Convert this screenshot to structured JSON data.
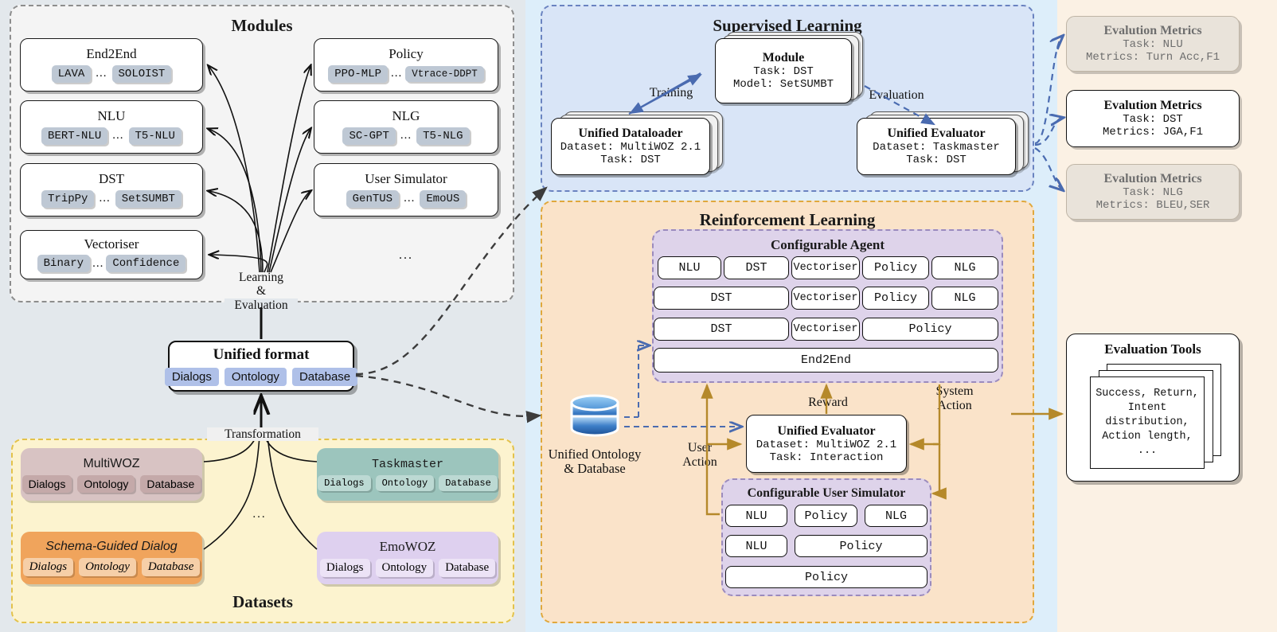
{
  "bands": {
    "left_bg": "#e3e8ec",
    "mid_bg": "#ddeefa",
    "right_bg": "#fbf1e4"
  },
  "modules": {
    "title": "Modules",
    "ellipsis": "...",
    "boxes": [
      {
        "name": "End2End",
        "title": "End2End",
        "left": "LAVA",
        "sep": "...",
        "right": "SOLOIST"
      },
      {
        "name": "NLU",
        "title": "NLU",
        "left": "BERT-NLU",
        "sep": "...",
        "right": "T5-NLU"
      },
      {
        "name": "DST",
        "title": "DST",
        "left": "TripPy",
        "sep": "...",
        "right": "SetSUMBT"
      },
      {
        "name": "Vectoriser",
        "title": "Vectoriser",
        "left": "Binary",
        "sep": "...",
        "right": "Confidence"
      },
      {
        "name": "Policy",
        "title": "Policy",
        "left": "PPO-MLP",
        "sep": "...",
        "right": "Vtrace-DDPT"
      },
      {
        "name": "NLG",
        "title": "NLG",
        "left": "SC-GPT",
        "sep": "...",
        "right": "T5-NLG"
      },
      {
        "name": "User Simulator",
        "title": "User Simulator",
        "left": "GenTUS",
        "sep": "...",
        "right": "EmoUS"
      }
    ]
  },
  "learning_eval_label": "Learning\n&\nEvaluation",
  "learning_eval_lines": [
    "Learning",
    "&",
    "Evaluation"
  ],
  "unified_format": {
    "title": "Unified format",
    "chips": [
      "Dialogs",
      "Ontology",
      "Database"
    ]
  },
  "transformation_label": "Transformation",
  "datasets": {
    "title": "Datasets",
    "ellipsis": "...",
    "items": [
      {
        "name": "MultiWOZ",
        "title": "MultiWOZ",
        "chips": [
          "Dialogs",
          "Ontology",
          "Database"
        ],
        "box_color": "#d8c3c3",
        "chip_color": "#c4a9a9",
        "font": "sans",
        "style": "normal",
        "title_color": "#1a1a1a"
      },
      {
        "name": "Taskmaster",
        "title": "Taskmaster",
        "chips": [
          "Dialogs",
          "Ontology",
          "Database"
        ],
        "box_color": "#9cc5bd",
        "chip_color": "#bcd9d3",
        "font": "mono",
        "style": "normal",
        "title_color": "#1a1a1a"
      },
      {
        "name": "Schema-Guided Dialog",
        "title": "Schema-Guided Dialog",
        "chips": [
          "Dialogs",
          "Ontology",
          "Database"
        ],
        "box_color": "#f0a košice",
        "chip_color": "#f6cfa8",
        "font": "sans",
        "style": "italic",
        "title_color": "#1a1a1a"
      },
      {
        "name": "EmoWOZ",
        "title": "EmoWOZ",
        "chips": [
          "Dialogs",
          "Ontology",
          "Database"
        ],
        "box_color": "#ded0ef",
        "chip_color": "#ece3f6",
        "font": "serif",
        "style": "normal",
        "title_color": "#1a1a1a"
      }
    ]
  },
  "supervised_learning": {
    "title": "Supervised Learning",
    "module_card": {
      "title": "Module",
      "lines": [
        "Task: DST",
        "Model: SetSUMBT"
      ]
    },
    "dataloader_card": {
      "title": "Unified Dataloader",
      "lines": [
        "Dataset: MultiWOZ 2.1",
        "Task: DST"
      ]
    },
    "evaluator_card": {
      "title": "Unified Evaluator",
      "lines": [
        "Dataset: Taskmaster",
        "Task: DST"
      ]
    },
    "training_label": "Training",
    "evaluation_label": "Evaluation"
  },
  "evaluation_metrics": [
    {
      "title": "Evalution Metrics",
      "task": "Task: NLU",
      "metrics": "Metrics: Turn Acc,F1",
      "active": false
    },
    {
      "title": "Evalution Metrics",
      "task": "Task: DST",
      "metrics": "Metrics: JGA,F1",
      "active": true
    },
    {
      "title": "Evalution Metrics",
      "task": "Task: NLG",
      "metrics": "Metrics: BLEU,SER",
      "active": false
    }
  ],
  "reinforcement_learning": {
    "title": "Reinforcement Learning",
    "agent": {
      "title": "Configurable Agent",
      "rows": [
        [
          "NLU",
          "DST",
          "Vectoriser",
          "Policy",
          "NLG"
        ],
        [
          "DST",
          "Vectoriser",
          "Policy",
          "NLG"
        ],
        [
          "DST",
          "Vectoriser",
          "Policy"
        ],
        [
          "End2End"
        ]
      ]
    },
    "evaluator_card": {
      "title": "Unified Evaluator",
      "lines": [
        "Dataset: MultiWOZ 2.1",
        "Task: Interaction"
      ]
    },
    "user_simulator": {
      "title": "Configurable User Simulator",
      "rows": [
        [
          "NLU",
          "Policy",
          "NLG"
        ],
        [
          "NLU",
          "Policy"
        ],
        [
          "Policy"
        ]
      ]
    },
    "db_label_lines": [
      "Unified Ontology",
      "& Database"
    ],
    "arrow_labels": {
      "reward": "Reward",
      "system_action_lines": [
        "System",
        "Action"
      ],
      "user_action_lines": [
        "User",
        "Action"
      ]
    }
  },
  "evaluation_tools": {
    "title": "Evaluation Tools",
    "lines": [
      "Success, Return,",
      "Intent",
      "distribution,",
      "Action length,",
      "..."
    ]
  },
  "colors": {
    "gold_arrow": "#b5892a",
    "blue_arrow": "#4a6bb0",
    "black_arrow": "#111111",
    "gray_arrow": "#3c3c3c"
  }
}
